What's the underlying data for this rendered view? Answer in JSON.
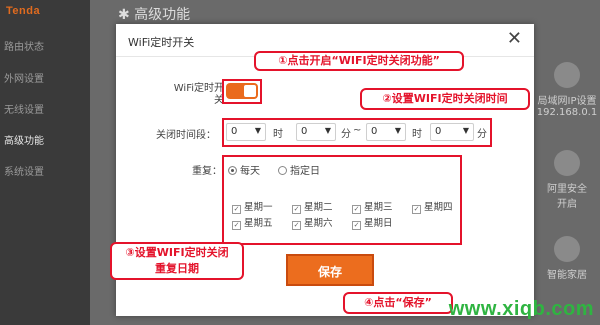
{
  "app": {
    "logo": "Tenda",
    "page_heading": "✱ 高级功能"
  },
  "sidebar": {
    "items": [
      {
        "label": "路由状态"
      },
      {
        "label": "外网设置"
      },
      {
        "label": "无线设置"
      },
      {
        "label": "高级功能",
        "active": true
      },
      {
        "label": "系统设置"
      }
    ]
  },
  "right_panel": {
    "items": [
      {
        "label": "局域网IP设置",
        "sub": "192.168.0.1"
      },
      {
        "label": "阿里安全",
        "sub": "开启"
      },
      {
        "label": "智能家居"
      }
    ]
  },
  "modal": {
    "title": "WiFi定时开关",
    "close_symbol": "✕",
    "toggle_label": "WiFi定时开关",
    "toggle_on": true,
    "time_label": "关闭时间段：",
    "start_hour": "0",
    "start_minute": "0",
    "end_hour": "0",
    "end_minute": "0",
    "unit_hour": "时",
    "unit_minute": "分",
    "range_sep": "~",
    "repeat_label": "重复：",
    "repeat_options": [
      "每天",
      "指定日"
    ],
    "repeat_selected": "每天",
    "weekdays": [
      "星期一",
      "星期二",
      "星期三",
      "星期四",
      "星期五",
      "星期六",
      "星期日"
    ],
    "save_label": "保存"
  },
  "annotations": {
    "step1": "①点击开启“WIFI定时关闭功能”",
    "step2": "②设置WIFI定时关闭时间",
    "step3_line1": "③设置WIFI定时关闭",
    "step3_line2": "重复日期",
    "step4": "④点击“保存”"
  },
  "watermark": "www.xiqb.com",
  "colors": {
    "accent": "#ec6d1e",
    "annotation": "#e4132b",
    "watermark": "#2fb441"
  }
}
